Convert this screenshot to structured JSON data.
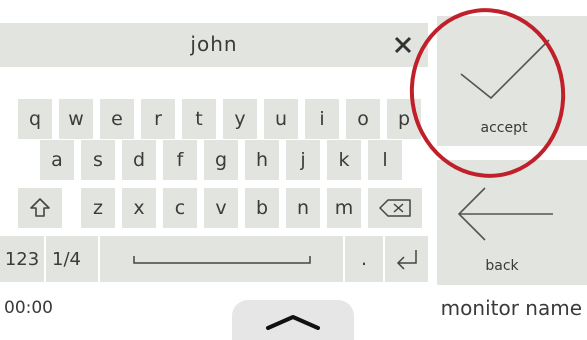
{
  "input": {
    "value": "john"
  },
  "keyboard": {
    "row1": [
      "q",
      "w",
      "e",
      "r",
      "t",
      "y",
      "u",
      "i",
      "o",
      "p"
    ],
    "row2": [
      "a",
      "s",
      "d",
      "f",
      "g",
      "h",
      "j",
      "k",
      "l"
    ],
    "row3": [
      "z",
      "x",
      "c",
      "v",
      "b",
      "n",
      "m"
    ],
    "row4": {
      "numbers": "123",
      "page": "1/4",
      "period": "."
    }
  },
  "buttons": {
    "accept": "accept",
    "back": "back"
  },
  "footer": {
    "time": "00:00",
    "monitor_name": "monitor name"
  },
  "colors": {
    "key_bg": "#e2e4e0",
    "highlight_ring": "#c0202a"
  }
}
